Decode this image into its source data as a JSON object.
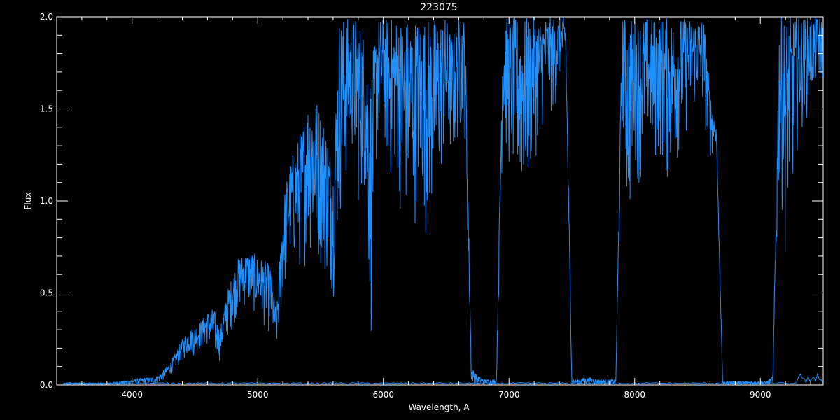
{
  "chart_data": {
    "type": "line",
    "title": "223075",
    "xlabel": "Wavelength, A",
    "ylabel": "Flux",
    "xlim": [
      3400,
      9500
    ],
    "ylim": [
      0.0,
      2.0
    ],
    "x_ticks": [
      4000,
      5000,
      6000,
      7000,
      8000,
      9000
    ],
    "x_tick_labels": [
      "4000",
      "5000",
      "6000",
      "7000",
      "8000",
      "9000"
    ],
    "y_ticks": [
      0.0,
      0.5,
      1.0,
      1.5,
      2.0
    ],
    "y_tick_labels": [
      "0.0",
      "0.5",
      "1.0",
      "1.5",
      "2.0"
    ],
    "grid": false,
    "background": "#000000",
    "axis_color": "#ffffff",
    "series": [
      {
        "color": "#1e90ff",
        "x": [
          3450,
          3600,
          3800,
          3900,
          4000,
          4100,
          4150,
          4200,
          4250,
          4300,
          4350,
          4400,
          4450,
          4500,
          4550,
          4600,
          4650,
          4700,
          4750,
          4800,
          4850,
          4900,
          4950,
          5000,
          5050,
          5100,
          5150,
          5200,
          5250,
          5300,
          5350,
          5400,
          5450,
          5500,
          5550,
          5600,
          5650,
          5700,
          5750,
          5800,
          5850,
          5900,
          5950,
          6000,
          6050,
          6100,
          6150,
          6200,
          6250,
          6300,
          6350,
          6400,
          6450,
          6500,
          6550,
          6600,
          6650,
          6700,
          6750,
          6800,
          6850,
          6900,
          6950,
          7000,
          7050,
          7100,
          7150,
          7200,
          7250,
          7300,
          7350,
          7400,
          7450,
          7500,
          7550,
          7600,
          7650,
          7700,
          7750,
          7800,
          7850,
          7900,
          7950,
          8000,
          8050,
          8100,
          8150,
          8200,
          8250,
          8300,
          8350,
          8400,
          8450,
          8500,
          8550,
          8600,
          8650,
          8700,
          8750,
          8800,
          8850,
          8900,
          8950,
          9000,
          9050,
          9100,
          9150,
          9200,
          9250,
          9300,
          9350,
          9400,
          9450,
          9500
        ],
        "upper": [
          0.01,
          0.01,
          0.01,
          0.02,
          0.03,
          0.04,
          0.04,
          0.05,
          0.08,
          0.12,
          0.18,
          0.25,
          0.3,
          0.32,
          0.35,
          0.4,
          0.42,
          0.3,
          0.5,
          0.6,
          0.7,
          0.72,
          0.73,
          0.7,
          0.68,
          0.65,
          0.4,
          1.0,
          1.2,
          1.3,
          1.4,
          1.55,
          1.6,
          1.5,
          1.4,
          1.2,
          2.0,
          2.0,
          2.0,
          2.0,
          1.9,
          1.7,
          2.0,
          2.0,
          2.0,
          2.0,
          2.0,
          2.0,
          2.0,
          2.0,
          2.0,
          2.0,
          2.0,
          2.0,
          1.9,
          2.0,
          2.0,
          0.1,
          0.05,
          0.03,
          0.03,
          0.03,
          2.0,
          2.0,
          2.0,
          2.0,
          2.0,
          2.0,
          2.0,
          2.0,
          2.0,
          2.0,
          2.0,
          0.03,
          0.03,
          0.04,
          0.04,
          0.03,
          0.03,
          0.03,
          0.03,
          2.0,
          2.0,
          2.0,
          2.0,
          2.0,
          2.0,
          2.0,
          2.0,
          2.0,
          2.0,
          2.0,
          2.0,
          2.0,
          2.0,
          1.6,
          1.4,
          0.02,
          0.02,
          0.02,
          0.02,
          0.02,
          0.02,
          0.02,
          0.02,
          0.05,
          2.0,
          2.0,
          2.0,
          2.0,
          2.0,
          2.0,
          2.0,
          2.0
        ],
        "lower": [
          0.0,
          0.0,
          0.0,
          0.0,
          0.0,
          0.0,
          0.0,
          0.0,
          0.02,
          0.05,
          0.08,
          0.12,
          0.15,
          0.15,
          0.18,
          0.2,
          0.13,
          0.12,
          0.22,
          0.3,
          0.38,
          0.4,
          0.38,
          0.35,
          0.3,
          0.25,
          0.15,
          0.4,
          0.6,
          0.6,
          0.55,
          0.7,
          0.55,
          0.6,
          0.5,
          0.45,
          0.8,
          1.0,
          1.2,
          0.9,
          1.0,
          0.1,
          1.2,
          1.3,
          1.0,
          1.1,
          0.8,
          0.75,
          0.85,
          0.9,
          0.75,
          0.8,
          1.0,
          1.2,
          1.1,
          1.3,
          1.3,
          0.0,
          0.0,
          0.0,
          0.0,
          0.0,
          1.3,
          1.1,
          1.0,
          0.9,
          0.95,
          1.2,
          1.3,
          1.5,
          1.4,
          1.6,
          1.7,
          0.0,
          0.0,
          0.0,
          0.0,
          0.0,
          0.0,
          0.0,
          0.0,
          1.4,
          0.7,
          1.2,
          1.0,
          1.3,
          1.1,
          1.2,
          1.0,
          1.1,
          1.2,
          1.3,
          1.4,
          1.5,
          1.4,
          1.2,
          1.3,
          0.0,
          0.0,
          0.0,
          0.0,
          0.0,
          0.0,
          0.0,
          0.0,
          0.0,
          1.0,
          0.7,
          0.9,
          1.3,
          1.4,
          1.5,
          1.6,
          1.6
        ]
      }
    ]
  }
}
